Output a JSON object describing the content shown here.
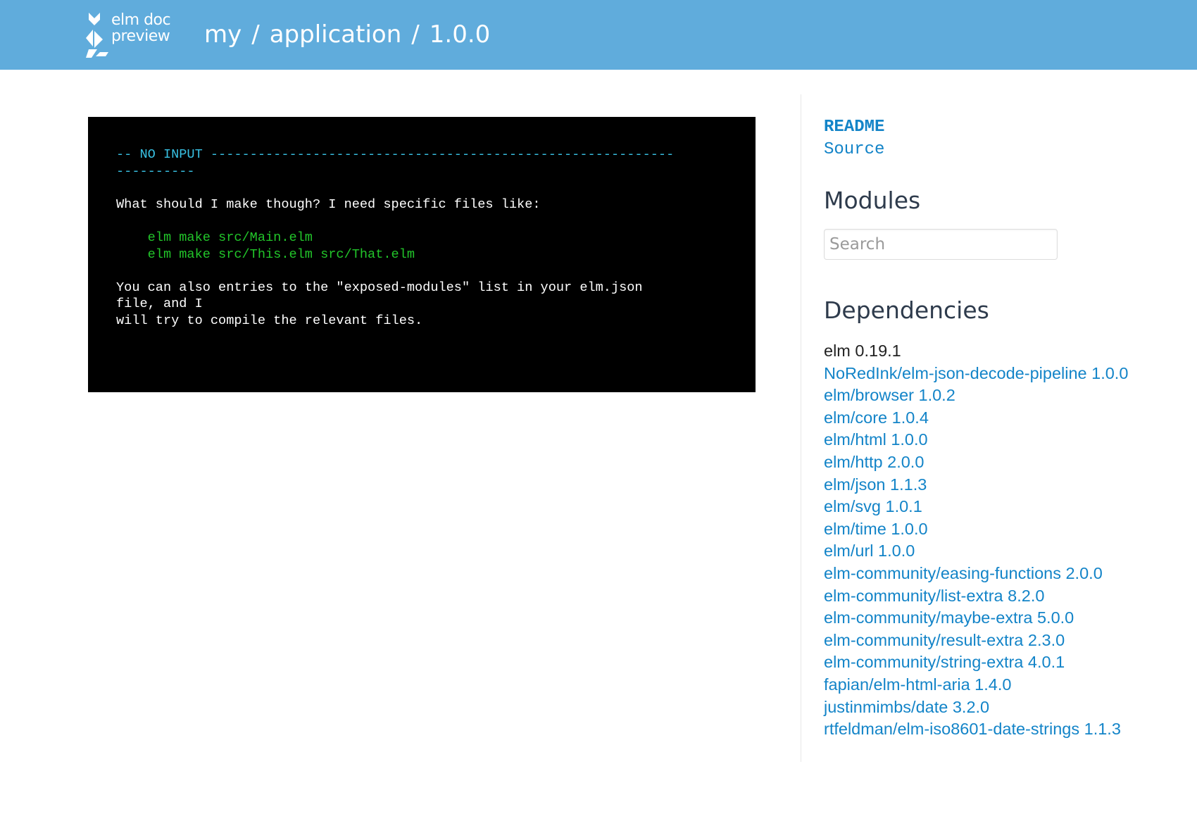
{
  "header": {
    "logo": {
      "line1": "elm doc",
      "line2": "preview"
    },
    "breadcrumb": {
      "user": "my",
      "separator1": "/",
      "project": "application",
      "separator2": "/",
      "version": "1.0.0"
    },
    "background_color": "#60acdc"
  },
  "terminal": {
    "heading_line1": "-- NO INPUT -----------------------------------------------------------",
    "heading_line2": "----------",
    "message1": "What should I make though? I need specific files like:",
    "example1": "    elm make src/Main.elm",
    "example2": "    elm make src/This.elm src/That.elm",
    "message2_line1": "You can also entries to the \"exposed-modules\" list in your elm.json",
    "message2_line2": "file, and I",
    "message2_line3": "will try to compile the relevant files.",
    "colors": {
      "heading": "#38c0e2",
      "code": "#22c52a",
      "text": "#ffffff",
      "background": "#000000"
    }
  },
  "sidebar": {
    "readme_label": "README",
    "source_label": "Source",
    "modules_title": "Modules",
    "search_placeholder": "Search",
    "search_value": "",
    "dependencies_title": "Dependencies",
    "elm_version": "elm 0.19.1",
    "dependencies": [
      "NoRedInk/elm-json-decode-pipeline 1.0.0",
      "elm/browser 1.0.2",
      "elm/core 1.0.4",
      "elm/html 1.0.0",
      "elm/http 2.0.0",
      "elm/json 1.1.3",
      "elm/svg 1.0.1",
      "elm/time 1.0.0",
      "elm/url 1.0.0",
      "elm-community/easing-functions 2.0.0",
      "elm-community/list-extra 8.2.0",
      "elm-community/maybe-extra 5.0.0",
      "elm-community/result-extra 2.3.0",
      "elm-community/string-extra 4.0.1",
      "fapian/elm-html-aria 1.4.0",
      "justinmimbs/date 3.2.0",
      "rtfeldman/elm-iso8601-date-strings 1.1.3"
    ],
    "link_color": "#1384c8"
  }
}
